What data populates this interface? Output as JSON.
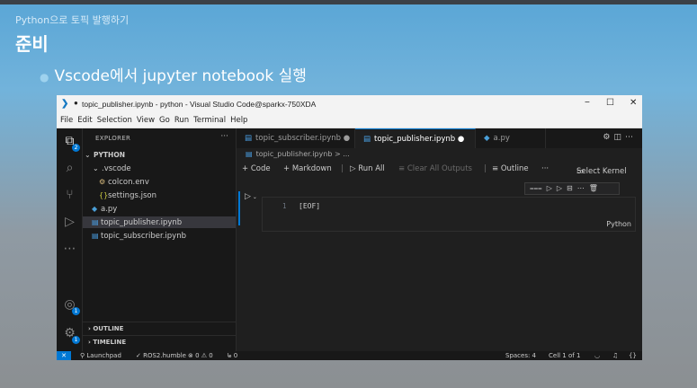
{
  "slide": {
    "subtitle": "Python으로 토픽 발행하기",
    "title": "준비",
    "bullet": "Vscode에서 jupyter notebook 실행"
  },
  "window": {
    "title": "topic_publisher.ipynb - python - Visual Studio Code@sparkx-750XDA",
    "minimize": "−",
    "maximize": "☐",
    "close": "✕"
  },
  "menu": [
    "File",
    "Edit",
    "Selection",
    "View",
    "Go",
    "Run",
    "Terminal",
    "Help"
  ],
  "activity_badges": {
    "explorer": "2",
    "accounts": "1",
    "manage": "1"
  },
  "explorer": {
    "header": "EXPLORER",
    "more": "···",
    "root": "PYTHON",
    "items": [
      ".vscode",
      "colcon.env",
      "settings.json",
      "a.py",
      "topic_publisher.ipynb",
      "topic_subscriber.ipynb"
    ],
    "outline": "OUTLINE",
    "timeline": "TIMELINE"
  },
  "tabs": [
    {
      "label": "topic_subscriber.ipynb",
      "state": "●"
    },
    {
      "label": "topic_publisher.ipynb",
      "state": "●"
    },
    {
      "label": "a.py",
      "state": ""
    }
  ],
  "breadcrumb": "topic_publisher.ipynb > ...",
  "toolbar": {
    "code": "+ Code",
    "markdown": "+ Markdown",
    "sep1": "|",
    "run_all": "▷ Run All",
    "clear": "≡ Clear All Outputs",
    "sep2": "|",
    "outline": "≡ Outline",
    "more": "···",
    "kernel": "Select Kernel"
  },
  "cell": {
    "line_number": "1",
    "code": "[EOF]",
    "language": "Python"
  },
  "status": {
    "remote": "✕",
    "launchpad": "Launchpad",
    "ros": "✓ ROS2.humble",
    "problems": "⊗ 0 ⚠ 0",
    "ports": "ᖚ 0",
    "spaces": "Spaces: 4",
    "cell": "Cell 1 of 1"
  }
}
